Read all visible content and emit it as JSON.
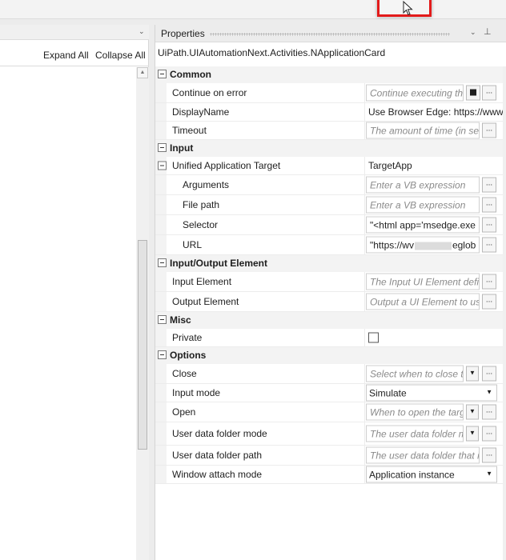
{
  "left_panel": {
    "expand_all": "Expand All",
    "collapse_all": "Collapse All"
  },
  "properties_panel": {
    "title": "Properties",
    "activity_type": "UiPath.UIAutomationNext.Activities.NApplicationCard",
    "categories": {
      "common": "Common",
      "input": "Input",
      "input_output": "Input/Output Element",
      "misc": "Misc",
      "options": "Options"
    },
    "rows": {
      "continue_on_error": {
        "label": "Continue on error",
        "placeholder": "Continue executing th"
      },
      "display_name": {
        "label": "DisplayName",
        "value": "Use Browser Edge: https://www"
      },
      "timeout": {
        "label": "Timeout",
        "placeholder": "The amount of time (in se"
      },
      "unified_target": {
        "label": "Unified Application Target",
        "value": "TargetApp"
      },
      "arguments": {
        "label": "Arguments",
        "placeholder": "Enter a VB expression"
      },
      "file_path": {
        "label": "File path",
        "placeholder": "Enter a VB expression"
      },
      "selector": {
        "label": "Selector",
        "value": "\"<html app='msedge.exe"
      },
      "url": {
        "label": "URL",
        "value_start": "\"https://wv",
        "value_end": "eglob"
      },
      "input_element": {
        "label": "Input Element",
        "placeholder": "The Input UI Element defi"
      },
      "output_element": {
        "label": "Output Element",
        "placeholder": "Output a UI Element to us"
      },
      "private": {
        "label": "Private",
        "checked": false
      },
      "close": {
        "label": "Close",
        "placeholder": "Select when to close th"
      },
      "input_mode": {
        "label": "Input mode",
        "value": "Simulate"
      },
      "open": {
        "label": "Open",
        "placeholder": "When to open the targ"
      },
      "user_data_folder_mode": {
        "label": "User data folder mode",
        "placeholder": "The user data folder m"
      },
      "user_data_folder_path": {
        "label": "User data folder path",
        "placeholder": "The user data folder that i"
      },
      "window_attach_mode": {
        "label": "Window attach mode",
        "value": "Application instance"
      }
    },
    "ellipsis": "...",
    "dropdown_caret": "▼"
  },
  "colors": {
    "highlight_border": "#e31b1b",
    "category_bg": "#f3f3f3",
    "placeholder_text": "#8a8a8a"
  }
}
